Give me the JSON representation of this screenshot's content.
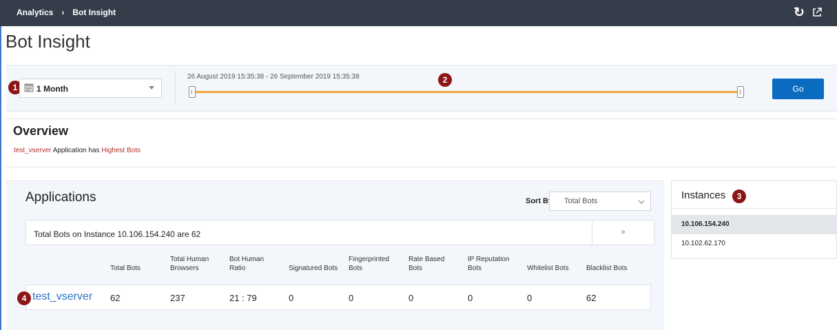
{
  "breadcrumb": {
    "parent": "Analytics",
    "separator": "›",
    "current": "Bot Insight"
  },
  "icons": {
    "refresh": "refresh-icon",
    "popout": "external-link-icon",
    "calendar": "calendar-icon"
  },
  "page_title": "Bot Insight",
  "filter": {
    "badge": "1",
    "period": "1 Month",
    "range_badge": "2",
    "range_text": "26 August 2019 15:35:38 - 26 September 2019 15:35:38",
    "go_label": "Go",
    "slider_start": 0,
    "slider_end": 1
  },
  "overview": {
    "title": "Overview",
    "app": "test_vserver",
    "mid": " Application has ",
    "highlight": "Highest Bots"
  },
  "applications": {
    "title": "Applications",
    "sort_by_label": "Sort By",
    "sort_value": "Total Bots",
    "total_text": "Total Bots on Instance 10.106.154.240 are 62",
    "total_arrow": ">",
    "columns": [
      [
        "",
        "Total Bots"
      ],
      [
        "Total Human",
        "Browsers"
      ],
      [
        "Bot Human",
        "Ratio"
      ],
      [
        "",
        "Signatured Bots"
      ],
      [
        "Fingerprinted",
        "Bots"
      ],
      [
        "Rate Based",
        "Bots"
      ],
      [
        "IP Reputation",
        "Bots"
      ],
      [
        "",
        "Whitelist Bots"
      ],
      [
        "",
        "Blacklist Bots"
      ]
    ],
    "row_badge": "4",
    "rows": [
      {
        "name": "test_vserver",
        "values": [
          "62",
          "237",
          "21 : 79",
          "0",
          "0",
          "0",
          "0",
          "0",
          "62"
        ]
      }
    ]
  },
  "instances": {
    "title": "Instances",
    "badge": "3",
    "items": [
      "10.106.154.240",
      "10.102.62.170"
    ],
    "selected_index": 0
  },
  "colors": {
    "topbar": "#363d4a",
    "accent": "#0b6bc1",
    "slider": "#f0a83a",
    "badge": "#8c1616",
    "highlight": "#b0302a",
    "link": "#2a72c4"
  }
}
